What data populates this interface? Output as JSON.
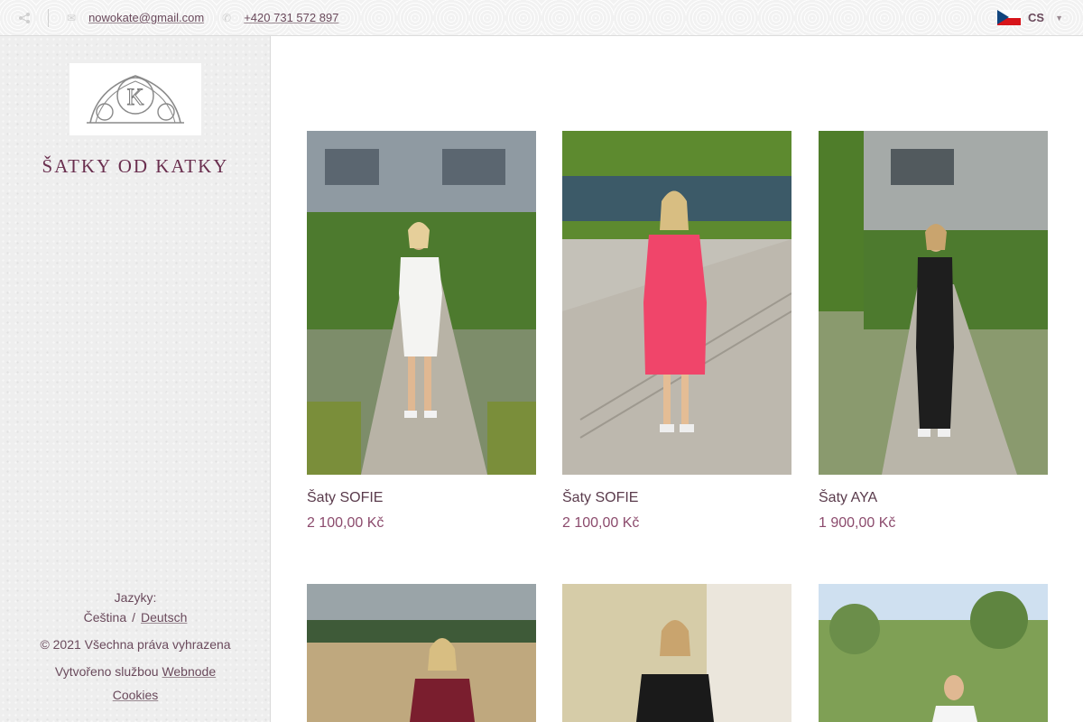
{
  "topbar": {
    "email": "nowokate@gmail.com",
    "phone": "+420 731 572 897",
    "language_code": "CS"
  },
  "sidebar": {
    "site_title": "ŠATKY OD KATKY",
    "logo_letter": "K",
    "languages_label": "Jazyky:",
    "language_current": "Čeština",
    "language_separator": "/",
    "language_other": "Deutsch",
    "copyright": "© 2021 Všechna práva vyhrazena",
    "created_by": "Vytvořeno službou",
    "created_by_link": "Webnode",
    "cookies": "Cookies"
  },
  "products": [
    {
      "name": "Šaty SOFIE",
      "price": "2 100,00 Kč",
      "dress_color": "#f4f4f2"
    },
    {
      "name": "Šaty SOFIE",
      "price": "2 100,00 Kč",
      "dress_color": "#f0456a"
    },
    {
      "name": "Šaty AYA",
      "price": "1 900,00 Kč",
      "dress_color": "#1e1e1e"
    },
    {
      "name": "",
      "price": "",
      "dress_color": "#7a1e2e"
    },
    {
      "name": "",
      "price": "",
      "dress_color": "#1a1a1a"
    },
    {
      "name": "",
      "price": "",
      "dress_color": "#f5f5f5"
    }
  ],
  "colors": {
    "accent": "#6a2f4f",
    "price": "#8b4a6c",
    "text": "#5a3b4c"
  }
}
